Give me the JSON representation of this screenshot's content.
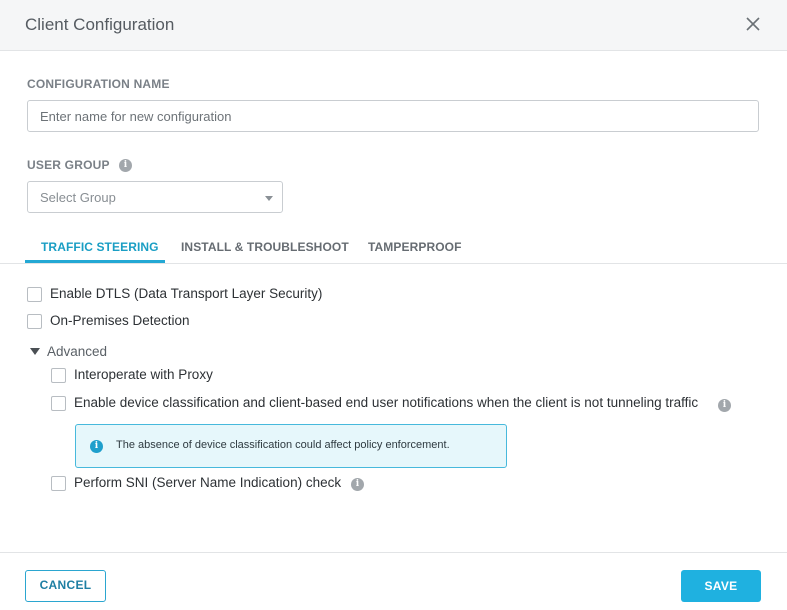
{
  "dialog": {
    "title": "Client Configuration"
  },
  "form": {
    "config_name_label": "CONFIGURATION NAME",
    "config_name_placeholder": "Enter name for new configuration",
    "config_name_value": "",
    "user_group_label": "USER GROUP",
    "user_group_selected": "Select Group"
  },
  "tabs": [
    {
      "label": "TRAFFIC STEERING",
      "active": true
    },
    {
      "label": "INSTALL & TROUBLESHOOT",
      "active": false
    },
    {
      "label": "TAMPERPROOF",
      "active": false
    }
  ],
  "options": {
    "enable_dtls": {
      "label": "Enable DTLS (Data Transport Layer Security)",
      "checked": false
    },
    "on_prem": {
      "label": "On-Premises Detection",
      "checked": false
    },
    "advanced_label": "Advanced",
    "proxy": {
      "label": "Interoperate with Proxy",
      "checked": false
    },
    "device_class": {
      "label": "Enable device classification and client-based end user notifications when the client is not tunneling traffic",
      "checked": false
    },
    "notice_text": "The absence of device classification could affect policy enforcement.",
    "sni": {
      "label": "Perform SNI (Server Name Indication) check",
      "checked": false
    }
  },
  "footer": {
    "cancel_label": "CANCEL",
    "save_label": "SAVE"
  },
  "colors": {
    "accent": "#1fb1e0",
    "active_tab": "#1a9ec4",
    "notice_bg": "#e6f7fb",
    "notice_border": "#47b9dc"
  },
  "icons": {
    "close": "close-icon",
    "info": "info-icon",
    "dropdown": "chevron-down-icon",
    "advanced_toggle": "caret-down-icon"
  }
}
